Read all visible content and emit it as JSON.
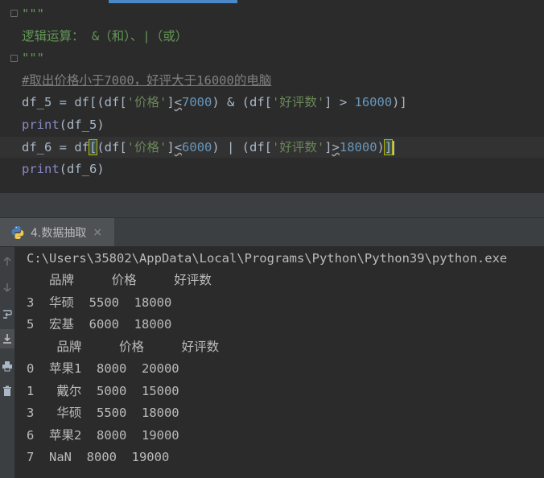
{
  "editor": {
    "lines": {
      "l1": "\"\"\"",
      "l2": "逻辑运算： &（和）、|（或）",
      "l3": "\"\"\"",
      "l4": "#取出价格小于7000，好评大于16000的电脑",
      "l5": {
        "a": "df_5 = df[(df[",
        "b": "'价格'",
        "c": "]",
        "d": "<",
        "e": "7000",
        "f": ") & (df[",
        "g": "'好评数'",
        "h": "] > ",
        "i": "16000",
        "j": ")]"
      },
      "l6": {
        "a": "print",
        "b": "(df_5)"
      },
      "l7": {
        "a": "df_6 = df",
        "b": "[",
        "c": "(df[",
        "d": "'价格'",
        "e": "]",
        "f": "<",
        "g": "6000",
        "h": ") | (df[",
        "i": "'好评数'",
        "j": "]",
        "k": ">",
        "l": "18000",
        "m": ")",
        "n": "]"
      },
      "l8": {
        "a": "print",
        "b": "(df_6)"
      }
    }
  },
  "run": {
    "tab_label": "4.数据抽取",
    "tab_close": "×",
    "output": [
      "C:\\Users\\35802\\AppData\\Local\\Programs\\Python\\Python39\\python.exe",
      "   品牌     价格     好评数",
      "3  华硕  5500  18000",
      "5  宏基  6000  18000",
      "    品牌     价格     好评数",
      "0  苹果1  8000  20000",
      "1   戴尔  5000  15000",
      "3   华硕  5500  18000",
      "6  苹果2  8000  19000",
      "7  NaN  8000  19000"
    ]
  },
  "icons": {
    "up": "arrow-up-icon",
    "down": "arrow-down-icon",
    "wrap": "soft-wrap-icon",
    "scroll_end": "scroll-to-end-icon",
    "print": "print-icon",
    "delete": "trash-icon"
  },
  "colors": {
    "editor_bg": "#2b2b2b",
    "docstring": "#629755",
    "comment": "#808080",
    "string": "#6a8759",
    "number": "#6897bb",
    "builtin": "#8888c6",
    "text": "#a9b7c6",
    "accent": "#4a88c7"
  }
}
